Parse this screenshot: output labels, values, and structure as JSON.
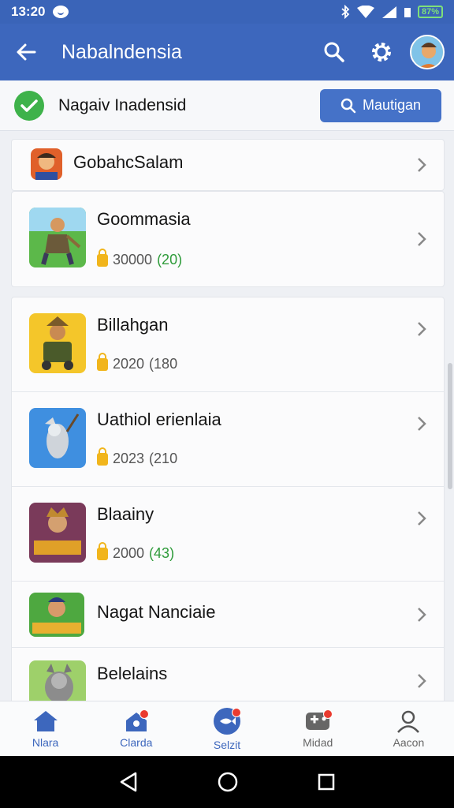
{
  "status_bar": {
    "time": "13:20",
    "battery": "87%"
  },
  "app_bar": {
    "title": "Nabalndensia"
  },
  "banner": {
    "text": "Nagaiv Inadensid",
    "button_label": "Mautigan"
  },
  "top_item": {
    "name": "GobahcSalam"
  },
  "games": [
    {
      "name": "Goommasia",
      "count": "30000",
      "paren": "(20)",
      "paren_color": "#2e9b3a"
    },
    {
      "name": "Billahgan",
      "count": "2020",
      "paren": "(180",
      "paren_color": "#555555"
    },
    {
      "name": "Uathiol erienlaia",
      "count": "2023",
      "paren": "(210",
      "paren_color": "#555555"
    },
    {
      "name": "Blaainy",
      "count": "2000",
      "paren": "(43)",
      "paren_color": "#2e9b3a"
    },
    {
      "name": "Nagat Nanciaie"
    },
    {
      "name": "Belelains"
    }
  ],
  "bottom_nav": [
    {
      "label": "Nlara",
      "icon": "home-icon",
      "active": true
    },
    {
      "label": "Clarda",
      "icon": "store-bag-icon",
      "active": true,
      "badge": true
    },
    {
      "label": "Selzit",
      "icon": "fish-icon",
      "active": true,
      "badge": true
    },
    {
      "label": "Midad",
      "icon": "gamepad-icon",
      "active": false,
      "badge": true
    },
    {
      "label": "Aacon",
      "icon": "person-icon",
      "active": false
    }
  ],
  "colors": {
    "primary": "#3d67bd",
    "success": "#3eb24a",
    "badge": "#ea3b2f",
    "coin": "#f1b51c"
  }
}
